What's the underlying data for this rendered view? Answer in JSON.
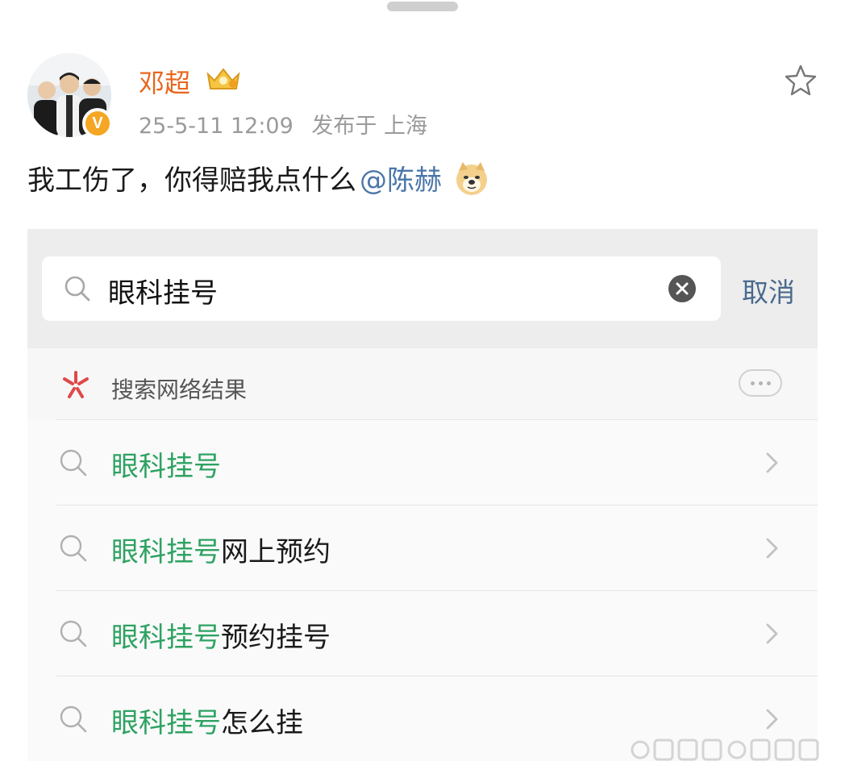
{
  "post": {
    "author": "邓超",
    "timestamp": "25-5-11 12:09",
    "location": "发布于 上海",
    "text": "我工伤了，你得赔我点什么",
    "mention": "@陈赫",
    "verified_badge": "V",
    "icons": {
      "favorite": "star-icon",
      "member_badge": "crown-badge-icon",
      "emoji": "doge-emoji-icon"
    },
    "colors": {
      "author": "#e8661c",
      "mention": "#4a76a8",
      "meta": "#9a9a9a"
    }
  },
  "screenshot": {
    "search": {
      "query": "眼科挂号",
      "cancel_label": "取消",
      "icons": {
        "search": "search-icon",
        "clear": "clear-circle-icon"
      }
    },
    "web_results": {
      "label": "搜索网络结果",
      "icon": "spark-icon",
      "more_icon": "ellipsis-icon"
    },
    "suggestions": [
      {
        "highlight": "眼科挂号",
        "rest": ""
      },
      {
        "highlight": "眼科挂号",
        "rest": "网上预约"
      },
      {
        "highlight": "眼科挂号",
        "rest": "预约挂号"
      },
      {
        "highlight": "眼科挂号",
        "rest": "怎么挂"
      }
    ],
    "colors": {
      "highlight": "#2ea262",
      "cancel": "#4a6a8e",
      "search_bar_bg": "#ededed"
    }
  }
}
